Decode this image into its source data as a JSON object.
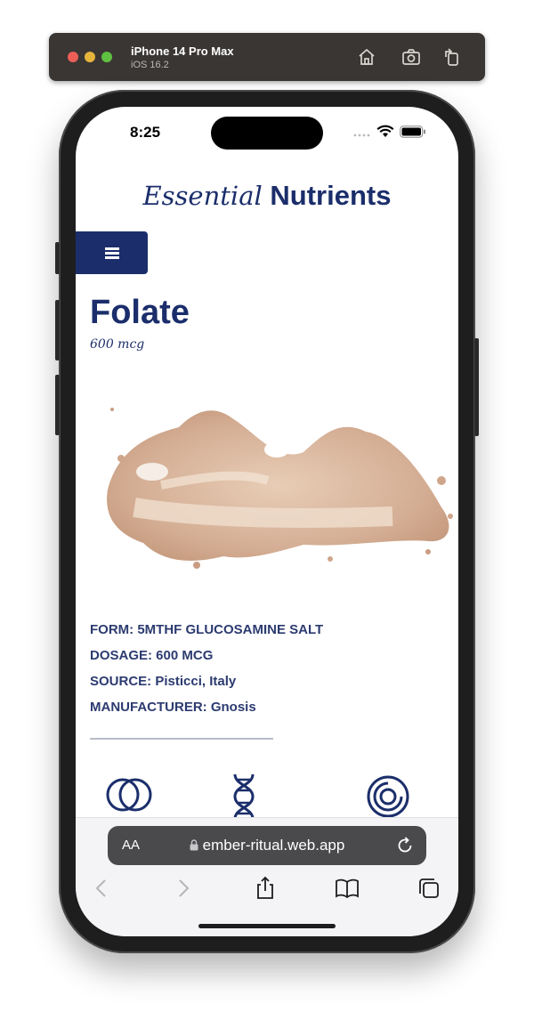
{
  "simulator": {
    "device": "iPhone 14 Pro Max",
    "os": "iOS 16.2",
    "toolbar_icons": [
      "home-icon",
      "screenshot-icon",
      "rotate-icon"
    ]
  },
  "status_bar": {
    "time": "8:25"
  },
  "site": {
    "brand_italic": "Essential",
    "brand_bold": "Nutrients",
    "menu_icon": "hamburger-icon"
  },
  "product": {
    "name": "Folate",
    "amount": "600 mcg",
    "image": "powder-pile",
    "specs": [
      "FORM: 5MTHF GLUCOSAMINE SALT",
      "DOSAGE: 600 MCG",
      "SOURCE: Pisticci, Italy",
      "MANUFACTURER: Gnosis"
    ],
    "feature_icons": [
      "overlapping-circles-icon",
      "dna-icon",
      "concentric-circles-icon"
    ]
  },
  "browser": {
    "text_size_label": "AA",
    "url": "ember-ritual.web.app",
    "nav": [
      "back-icon",
      "forward-icon",
      "share-icon",
      "bookmarks-icon",
      "tabs-icon"
    ]
  },
  "colors": {
    "brand": "#1b2e6b",
    "spec_text": "#2c3b70"
  }
}
